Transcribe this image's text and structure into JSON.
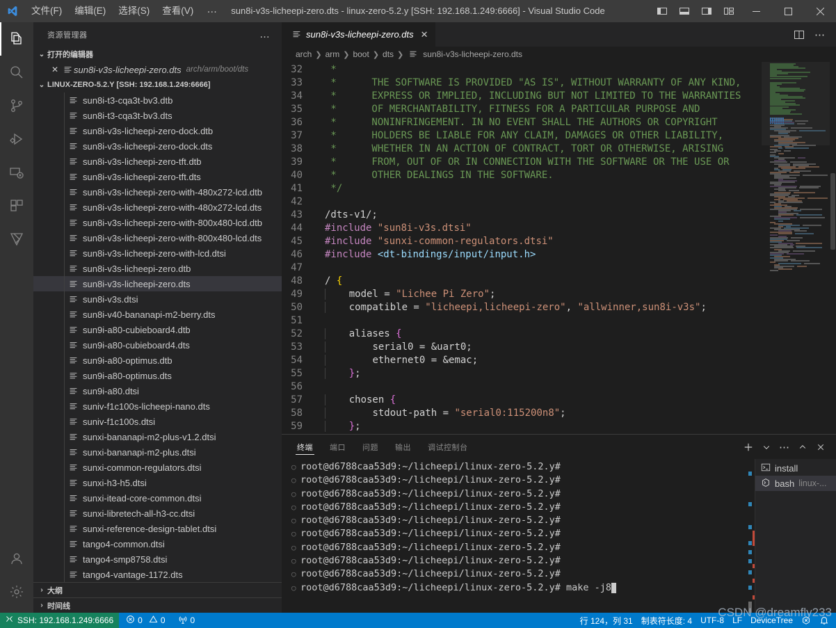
{
  "titlebar": {
    "menus": [
      "文件(F)",
      "编辑(E)",
      "选择(S)",
      "查看(V)"
    ],
    "more": "…",
    "title": "sun8i-v3s-licheepi-zero.dts - linux-zero-5.2.y [SSH: 192.168.1.249:6666] - Visual Studio Code",
    "layout_buttons": [
      "toggle-primary-sidebar",
      "toggle-panel",
      "toggle-secondary-sidebar",
      "customize-layout"
    ],
    "window_buttons": [
      "minimize",
      "maximize",
      "close"
    ]
  },
  "activitybar": {
    "items": [
      {
        "name": "explorer",
        "icon": "files-icon",
        "active": true
      },
      {
        "name": "search",
        "icon": "search-icon",
        "active": false
      },
      {
        "name": "source-control",
        "icon": "source-control-icon",
        "active": false
      },
      {
        "name": "run-and-debug",
        "icon": "debug-icon",
        "active": false
      },
      {
        "name": "remote-explorer",
        "icon": "remote-explorer-icon",
        "active": false
      },
      {
        "name": "extensions",
        "icon": "extensions-icon",
        "active": false
      },
      {
        "name": "extension-custom",
        "icon": "custom-extension-icon",
        "active": false
      }
    ],
    "bottom": [
      {
        "name": "accounts",
        "icon": "account-icon"
      },
      {
        "name": "manage",
        "icon": "gear-icon"
      }
    ]
  },
  "sidebar": {
    "title": "资源管理器",
    "more_actions": "…",
    "open_editors": {
      "label": "打开的编辑器",
      "items": [
        {
          "name": "sun8i-v3s-licheepi-zero.dts",
          "path": "arch/arm/boot/dts",
          "close": "✕"
        }
      ]
    },
    "folder": {
      "label": "LINUX-ZERO-5.2.Y [SSH: 192.168.1.249:6666]",
      "files": [
        "sun8i-t3-cqa3t-bv3.dtb",
        "sun8i-t3-cqa3t-bv3.dts",
        "sun8i-v3s-licheepi-zero-dock.dtb",
        "sun8i-v3s-licheepi-zero-dock.dts",
        "sun8i-v3s-licheepi-zero-tft.dtb",
        "sun8i-v3s-licheepi-zero-tft.dts",
        "sun8i-v3s-licheepi-zero-with-480x272-lcd.dtb",
        "sun8i-v3s-licheepi-zero-with-480x272-lcd.dts",
        "sun8i-v3s-licheepi-zero-with-800x480-lcd.dtb",
        "sun8i-v3s-licheepi-zero-with-800x480-lcd.dts",
        "sun8i-v3s-licheepi-zero-with-lcd.dtsi",
        "sun8i-v3s-licheepi-zero.dtb",
        "sun8i-v3s-licheepi-zero.dts",
        "sun8i-v3s.dtsi",
        "sun8i-v40-bananapi-m2-berry.dts",
        "sun9i-a80-cubieboard4.dtb",
        "sun9i-a80-cubieboard4.dts",
        "sun9i-a80-optimus.dtb",
        "sun9i-a80-optimus.dts",
        "sun9i-a80.dtsi",
        "suniv-f1c100s-licheepi-nano.dts",
        "suniv-f1c100s.dtsi",
        "sunxi-bananapi-m2-plus-v1.2.dtsi",
        "sunxi-bananapi-m2-plus.dtsi",
        "sunxi-common-regulators.dtsi",
        "sunxi-h3-h5.dtsi",
        "sunxi-itead-core-common.dtsi",
        "sunxi-libretech-all-h3-cc.dtsi",
        "sunxi-reference-design-tablet.dtsi",
        "tango4-common.dtsi",
        "tango4-smp8758.dtsi",
        "tango4-vantage-1172.dts"
      ],
      "selected_file": "sun8i-v3s-licheepi-zero.dts"
    },
    "bottom_sections": [
      "大纲",
      "时间线"
    ]
  },
  "editor": {
    "tab": {
      "name": "sun8i-v3s-licheepi-zero.dts",
      "close": "✕",
      "icon": "dts-file-icon"
    },
    "tab_actions": [
      "split-editor",
      "more-actions"
    ],
    "breadcrumb": [
      "arch",
      "arm",
      "boot",
      "dts",
      "sun8i-v3s-licheepi-zero.dts"
    ],
    "first_line_number": 32,
    "lines": [
      {
        "n": 32,
        "tokens": [
          {
            "t": " *",
            "c": "c-comment"
          }
        ]
      },
      {
        "n": 33,
        "tokens": [
          {
            "t": " *      THE SOFTWARE IS PROVIDED \"AS IS\", WITHOUT WARRANTY OF ANY KIND,",
            "c": "c-comment"
          }
        ]
      },
      {
        "n": 34,
        "tokens": [
          {
            "t": " *      EXPRESS OR IMPLIED, INCLUDING BUT NOT LIMITED TO THE WARRANTIES",
            "c": "c-comment"
          }
        ]
      },
      {
        "n": 35,
        "tokens": [
          {
            "t": " *      OF MERCHANTABILITY, FITNESS FOR A PARTICULAR PURPOSE AND",
            "c": "c-comment"
          }
        ]
      },
      {
        "n": 36,
        "tokens": [
          {
            "t": " *      NONINFRINGEMENT. IN NO EVENT SHALL THE AUTHORS OR COPYRIGHT",
            "c": "c-comment"
          }
        ]
      },
      {
        "n": 37,
        "tokens": [
          {
            "t": " *      HOLDERS BE LIABLE FOR ANY CLAIM, DAMAGES OR OTHER LIABILITY,",
            "c": "c-comment"
          }
        ]
      },
      {
        "n": 38,
        "tokens": [
          {
            "t": " *      WHETHER IN AN ACTION OF CONTRACT, TORT OR OTHERWISE, ARISING",
            "c": "c-comment"
          }
        ]
      },
      {
        "n": 39,
        "tokens": [
          {
            "t": " *      FROM, OUT OF OR IN CONNECTION WITH THE SOFTWARE OR THE USE OR",
            "c": "c-comment"
          }
        ]
      },
      {
        "n": 40,
        "tokens": [
          {
            "t": " *      OTHER DEALINGS IN THE SOFTWARE.",
            "c": "c-comment"
          }
        ]
      },
      {
        "n": 41,
        "tokens": [
          {
            "t": " */",
            "c": "c-comment"
          }
        ]
      },
      {
        "n": 42,
        "tokens": []
      },
      {
        "n": 43,
        "tokens": [
          {
            "t": "/dts-v1/;",
            "c": "c-plain"
          }
        ]
      },
      {
        "n": 44,
        "tokens": [
          {
            "t": "#include",
            "c": "c-keyword"
          },
          {
            "t": " ",
            "c": "c-plain"
          },
          {
            "t": "\"sun8i-v3s.dtsi\"",
            "c": "c-string"
          }
        ]
      },
      {
        "n": 45,
        "tokens": [
          {
            "t": "#include",
            "c": "c-keyword"
          },
          {
            "t": " ",
            "c": "c-plain"
          },
          {
            "t": "\"sunxi-common-regulators.dtsi\"",
            "c": "c-string"
          }
        ]
      },
      {
        "n": 46,
        "tokens": [
          {
            "t": "#include",
            "c": "c-keyword"
          },
          {
            "t": " ",
            "c": "c-plain"
          },
          {
            "t": "<dt-bindings/input/input.h>",
            "c": "c-prop"
          }
        ]
      },
      {
        "n": 47,
        "tokens": []
      },
      {
        "n": 48,
        "tokens": [
          {
            "t": "/ ",
            "c": "c-plain"
          },
          {
            "t": "{",
            "c": "c-brace"
          }
        ]
      },
      {
        "n": 49,
        "tokens": [
          {
            "t": "    ",
            "c": "ind-guide"
          },
          {
            "t": "model = ",
            "c": "c-plain"
          },
          {
            "t": "\"Lichee Pi Zero\"",
            "c": "c-string"
          },
          {
            "t": ";",
            "c": "c-plain"
          }
        ]
      },
      {
        "n": 50,
        "tokens": [
          {
            "t": "    ",
            "c": "ind-guide"
          },
          {
            "t": "compatible = ",
            "c": "c-plain"
          },
          {
            "t": "\"licheepi,licheepi-zero\"",
            "c": "c-string"
          },
          {
            "t": ", ",
            "c": "c-plain"
          },
          {
            "t": "\"allwinner,sun8i-v3s\"",
            "c": "c-string"
          },
          {
            "t": ";",
            "c": "c-plain"
          }
        ]
      },
      {
        "n": 51,
        "tokens": []
      },
      {
        "n": 52,
        "tokens": [
          {
            "t": "    ",
            "c": "ind-guide"
          },
          {
            "t": "aliases ",
            "c": "c-plain"
          },
          {
            "t": "{",
            "c": "c-brace2"
          }
        ]
      },
      {
        "n": 53,
        "tokens": [
          {
            "t": "        ",
            "c": "ind-guide"
          },
          {
            "t": "serial0 = &uart0;",
            "c": "c-plain"
          }
        ]
      },
      {
        "n": 54,
        "tokens": [
          {
            "t": "        ",
            "c": "ind-guide"
          },
          {
            "t": "ethernet0 = &emac;",
            "c": "c-plain"
          }
        ]
      },
      {
        "n": 55,
        "tokens": [
          {
            "t": "    ",
            "c": "ind-guide"
          },
          {
            "t": "}",
            "c": "c-brace2"
          },
          {
            "t": ";",
            "c": "c-plain"
          }
        ]
      },
      {
        "n": 56,
        "tokens": []
      },
      {
        "n": 57,
        "tokens": [
          {
            "t": "    ",
            "c": "ind-guide"
          },
          {
            "t": "chosen ",
            "c": "c-plain"
          },
          {
            "t": "{",
            "c": "c-brace2"
          }
        ]
      },
      {
        "n": 58,
        "tokens": [
          {
            "t": "        ",
            "c": "ind-guide"
          },
          {
            "t": "stdout-path = ",
            "c": "c-plain"
          },
          {
            "t": "\"serial0:115200n8\"",
            "c": "c-string"
          },
          {
            "t": ";",
            "c": "c-plain"
          }
        ]
      },
      {
        "n": 59,
        "tokens": [
          {
            "t": "    ",
            "c": "ind-guide"
          },
          {
            "t": "}",
            "c": "c-brace2"
          },
          {
            "t": ";",
            "c": "c-plain"
          }
        ]
      }
    ]
  },
  "panel": {
    "tabs": [
      {
        "label": "终端",
        "active": true
      },
      {
        "label": "端口",
        "active": false
      },
      {
        "label": "问题",
        "active": false
      },
      {
        "label": "输出",
        "active": false
      },
      {
        "label": "调试控制台",
        "active": false
      }
    ],
    "actions": [
      "new-terminal",
      "chevron-down-icon",
      "more-actions",
      "maximize-panel",
      "close-panel"
    ],
    "terminal": {
      "prompt": "root@d6788caa53d9:~/licheepi/linux-zero-5.2.y#",
      "lines": [
        {
          "prompt": "root@d6788caa53d9:~/licheepi/linux-zero-5.2.y#",
          "command": ""
        },
        {
          "prompt": "root@d6788caa53d9:~/licheepi/linux-zero-5.2.y#",
          "command": ""
        },
        {
          "prompt": "root@d6788caa53d9:~/licheepi/linux-zero-5.2.y#",
          "command": ""
        },
        {
          "prompt": "root@d6788caa53d9:~/licheepi/linux-zero-5.2.y#",
          "command": ""
        },
        {
          "prompt": "root@d6788caa53d9:~/licheepi/linux-zero-5.2.y#",
          "command": ""
        },
        {
          "prompt": "root@d6788caa53d9:~/licheepi/linux-zero-5.2.y#",
          "command": ""
        },
        {
          "prompt": "root@d6788caa53d9:~/licheepi/linux-zero-5.2.y#",
          "command": ""
        },
        {
          "prompt": "root@d6788caa53d9:~/licheepi/linux-zero-5.2.y#",
          "command": ""
        },
        {
          "prompt": "root@d6788caa53d9:~/licheepi/linux-zero-5.2.y#",
          "command": ""
        },
        {
          "prompt": "root@d6788caa53d9:~/licheepi/linux-zero-5.2.y#",
          "command": " make -j8"
        }
      ]
    },
    "terminal_list": [
      {
        "label": "install",
        "sub": "",
        "icon": "terminal-icon",
        "selected": false
      },
      {
        "label": "bash",
        "sub": "linux-...",
        "icon": "bash-icon",
        "selected": true
      }
    ]
  },
  "statusbar": {
    "remote": "SSH: 192.168.1.249:6666",
    "errors": "0",
    "warnings": "0",
    "ports": "0",
    "position": "行 124，列 31",
    "tab_size": "制表符长度: 4",
    "encoding": "UTF-8",
    "eol": "LF",
    "language": "DeviceTree",
    "watermark": "CSDN @dreamfly233"
  },
  "colors": {
    "accent": "#007acc",
    "remote_green": "#16825d",
    "titlebar_bg": "#3c3c3c",
    "sidebar_bg": "#252526",
    "editor_bg": "#1e1e1e",
    "activitybar_bg": "#333333",
    "selection_bg": "#37373d"
  }
}
